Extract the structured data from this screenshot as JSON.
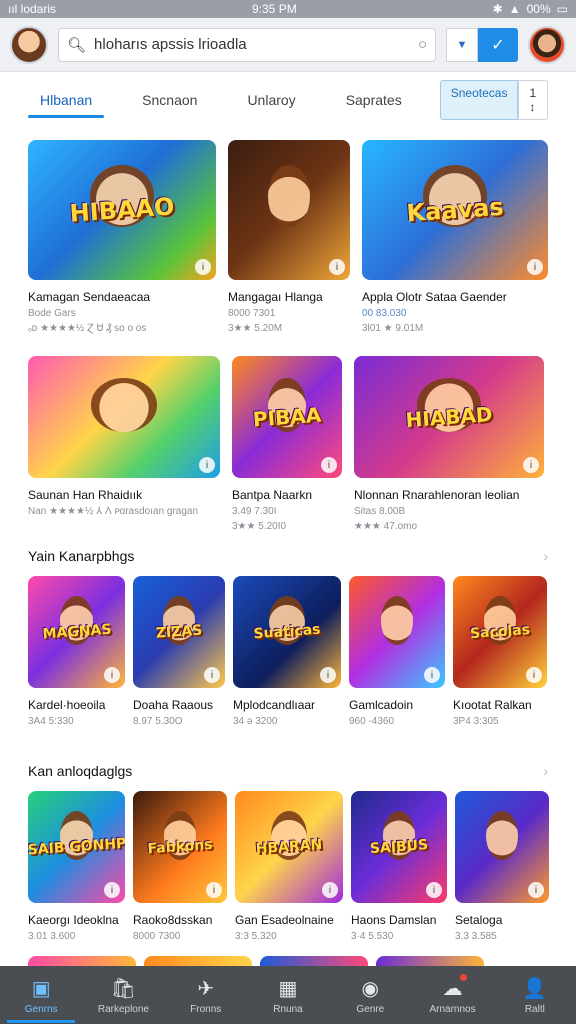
{
  "status": {
    "carrier": "ııl lodaris",
    "time": "9:35 PM",
    "battery": "00%"
  },
  "search": {
    "value": "hloharıs apssis lrioadla"
  },
  "tabs": [
    {
      "label": "Hlbanan"
    },
    {
      "label": "Sncnaon"
    },
    {
      "label": "Unlaroy"
    },
    {
      "label": "Saprates"
    }
  ],
  "tab_actions": {
    "primary": "Sneotecas",
    "secondary": "1 ↕"
  },
  "featured_rows": [
    [
      {
        "title": "Kamagan Sendaeacaa",
        "meta1": "Bode Gars",
        "meta2": "ₒᴅ ★★★★½ Ɀ Ꮜ ₰ sᴏ ᴏ ᴏs",
        "art": "HIBAAO",
        "bg": "linear-gradient(135deg,#2fb4ff,#1f6fd6 45%,#59c43b 80%,#f3a51f)"
      },
      {
        "title": "Mangagaı Hlanga",
        "meta1": "8000 7301",
        "meta2": "3★★ 5.20M",
        "art": "",
        "bg": "linear-gradient(135deg,#3b1d10,#6d3415 50%,#f0a83a)"
      },
      {
        "title": "Appla Olotr Sataa Gaender",
        "meta1": "00 83.030",
        "meta2": "3l01 ★ 9.01M",
        "art": "Kaavas",
        "bg": "linear-gradient(135deg,#27b6ff,#2d6fd8 50%,#ff8b2b)",
        "blue": true
      }
    ],
    [
      {
        "title": "Saunan Han Rhaidıık",
        "meta1": "Nan ★★★★½ ⅄ Ʌ ᴘɑrasdoıan gragan",
        "meta2": "",
        "art": "",
        "bg": "linear-gradient(135deg,#ff5ab0,#ffd54a 45%,#56d06a 70%,#1e9ee8)"
      },
      {
        "title": "Bantpa Naarkn",
        "meta1": "3.49 7.30I",
        "meta2": "3★★ 5.20I0",
        "art": "PIBAA",
        "bg": "linear-gradient(135deg,#ff8a1e,#8a2bd8 50%,#ff4a7a)"
      },
      {
        "title": "Nlonnan Rnarahlenoran leolian",
        "meta1": "Sitas 8.00B",
        "meta2": "★★★ 47.omo",
        "art": "HIABAD",
        "bg": "linear-gradient(135deg,#7a2bd6,#d43a8b 50%,#ffb23a)"
      }
    ]
  ],
  "sections": [
    {
      "title": "Yain Kanarpbhgs",
      "items": [
        {
          "title": "Kardel·hoeoila",
          "meta": "3A4 5:330",
          "art": "MAGNAS",
          "bg": "linear-gradient(135deg,#ff4aa8,#7b2fe0 50%,#ffb63a)"
        },
        {
          "title": "Doaha Raaous",
          "meta": "8.97 5.30O",
          "art": "ZIZAS",
          "bg": "linear-gradient(135deg,#1860d8,#2a3cb0 50%,#ffc94a)"
        },
        {
          "title": "Mplodcandlıaar",
          "meta": "34 ə 3200",
          "art": "Suaticas",
          "bg": "linear-gradient(135deg,#1b4bbb,#0d1e5c 60%,#ffb53a)"
        },
        {
          "title": "Gamlcadoin",
          "meta": "960 -4360",
          "art": "",
          "bg": "linear-gradient(135deg,#ff5a2a,#b12ee0 50%,#3ac8ff)"
        },
        {
          "title": "Kıootat Ralkan",
          "meta": "3P4 3:305",
          "art": "Sacolas",
          "bg": "linear-gradient(135deg,#ff8a1e,#b3261e 50%,#ffd23a)"
        }
      ]
    },
    {
      "title": "Kan anloqdaglgs",
      "items": [
        {
          "title": "Kaeorgı Ideoklna",
          "meta": "3.01 3.600",
          "art": "SAIB GONHP",
          "bg": "linear-gradient(135deg,#28d07a,#1d8de0 50%,#ff4aa8)"
        },
        {
          "title": "Raoko8dsskan",
          "meta": "8000 7300",
          "art": "Fabkons",
          "bg": "linear-gradient(135deg,#3a1a0c,#ff7a1e 60%,#ffc93a)"
        },
        {
          "title": "Gan Esadeolnaine",
          "meta": "3:3 5.320",
          "art": "HBARAN",
          "bg": "linear-gradient(135deg,#ff8a1e,#ffd44a 50%,#a02ae0)"
        },
        {
          "title": "Haons Damslan",
          "meta": "3·4 5.530",
          "art": "SAIBUS",
          "bg": "linear-gradient(135deg,#1d2b8c,#6a2dd8 50%,#ff3a6a)"
        },
        {
          "title": "Setaloga",
          "meta": "3.3 3.585",
          "art": "",
          "bg": "linear-gradient(135deg,#1e5ad8,#5a2ac8 50%,#ff9a2a)"
        }
      ]
    }
  ],
  "bottom_nav": [
    {
      "label": "Genrns",
      "icon": "▣",
      "icon_name": "store-icon",
      "active": true
    },
    {
      "label": "Rarkeplone",
      "icon": "🛍",
      "icon_name": "bag-icon"
    },
    {
      "label": "Fronns",
      "icon": "✈",
      "icon_name": "plane-icon"
    },
    {
      "label": "Rnuna",
      "icon": "▦",
      "icon_name": "grid-icon"
    },
    {
      "label": "Genre",
      "icon": "◉",
      "icon_name": "gamepad-icon"
    },
    {
      "label": "Arnarnnos",
      "icon": "☁",
      "icon_name": "cloud-icon",
      "dot": true
    },
    {
      "label": "Raltl",
      "icon": "👤",
      "icon_name": "profile-icon"
    }
  ]
}
